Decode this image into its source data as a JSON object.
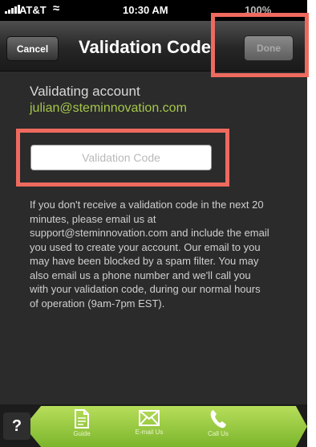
{
  "status_bar": {
    "carrier": "AT&T",
    "time": "10:30 AM",
    "battery": "100%"
  },
  "nav": {
    "cancel_label": "Cancel",
    "title": "Validation Code",
    "done_label": "Done"
  },
  "content": {
    "validating_label": "Validating account",
    "account_email": "julian@steminnovation.com",
    "code_placeholder": "Validation Code",
    "help_text": "If you don't receive a validation code in the next 20 minutes, please email us at support@steminnovation.com and include the email you used to create your account. Our email to you may have been blocked by a spam filter. You may also email us a phone number and we'll call you with your validation code, during our normal hours of operation (9am-7pm EST)."
  },
  "tab_bar": {
    "help_label": "?",
    "tabs": [
      {
        "label": "Guide",
        "icon": "document-icon"
      },
      {
        "label": "E-mail Us",
        "icon": "envelope-icon"
      },
      {
        "label": "Call Us",
        "icon": "phone-icon"
      }
    ]
  },
  "colors": {
    "accent_green": "#a5c74a",
    "highlight_red": "#ef6a5e",
    "background": "#2b2b2b"
  }
}
